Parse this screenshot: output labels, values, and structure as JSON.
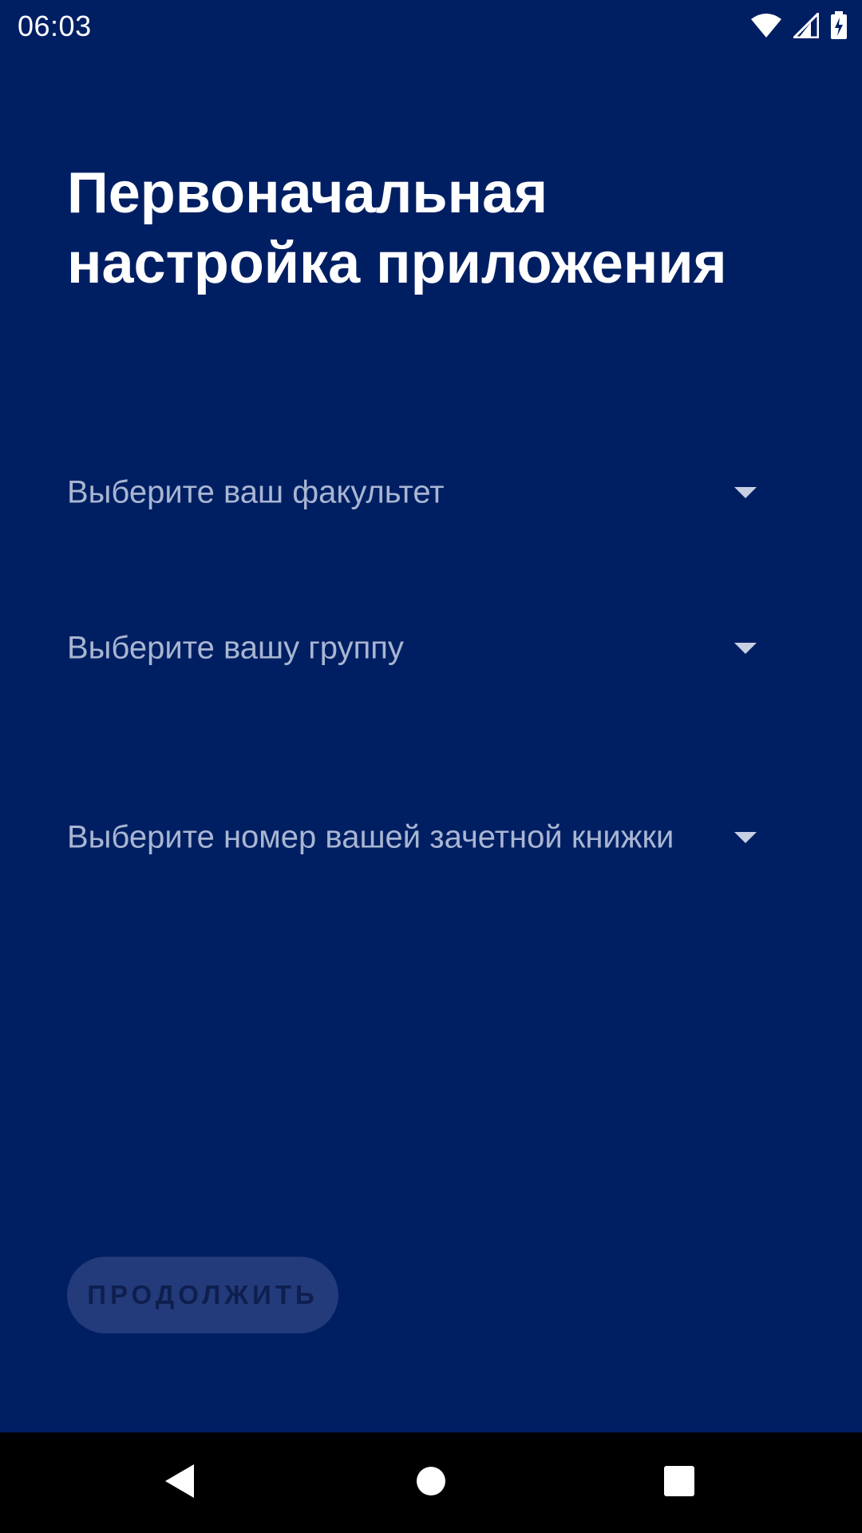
{
  "status_bar": {
    "time": "06:03",
    "icons": [
      "wifi-icon",
      "cellular-signal-icon",
      "battery-charging-icon"
    ]
  },
  "setup": {
    "title": "Первоначальная настройка приложения",
    "faculty_placeholder": "Выберите ваш факультет",
    "group_placeholder": "Выберите вашу группу",
    "record_book_placeholder": "Выберите номер вашей зачетной книжки",
    "continue_label": "ПРОДОЛЖИТЬ"
  },
  "nav_bar": {
    "icons": [
      "back-icon",
      "home-icon",
      "recents-icon"
    ]
  },
  "colors": {
    "background": "#001f63",
    "button_disabled": "#233b7a",
    "placeholder_text": "#a9b6d2"
  }
}
